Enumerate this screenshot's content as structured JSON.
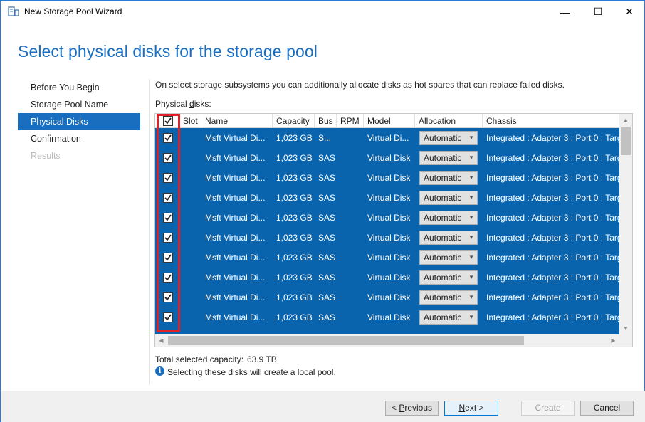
{
  "window": {
    "title": "New Storage Pool Wizard",
    "minimize_glyph": "—",
    "maximize_glyph": "☐",
    "close_glyph": "✕"
  },
  "page": {
    "heading": "Select physical disks for the storage pool",
    "intro": "On select storage subsystems you can additionally allocate disks as hot spares that can replace failed disks.",
    "physical_disks_label_prefix": "Physical ",
    "physical_disks_label_underlined": "d",
    "physical_disks_label_suffix": "isks:"
  },
  "nav": {
    "items": [
      {
        "label": "Before You Begin",
        "state": "normal"
      },
      {
        "label": "Storage Pool Name",
        "state": "normal"
      },
      {
        "label": "Physical Disks",
        "state": "active"
      },
      {
        "label": "Confirmation",
        "state": "normal"
      },
      {
        "label": "Results",
        "state": "disabled"
      }
    ]
  },
  "grid": {
    "columns": [
      "Slot",
      "Name",
      "Capacity",
      "Bus",
      "RPM",
      "Model",
      "Allocation",
      "Chassis"
    ],
    "rows": [
      {
        "checked": true,
        "slot": "",
        "name": "Msft Virtual Di...",
        "capacity": "1,023 GB",
        "bus": "S...",
        "rpm": "",
        "model": "Virtual Di...",
        "allocation": "Automatic",
        "chassis": "Integrated : Adapter 3 : Port 0 : Targ"
      },
      {
        "checked": true,
        "slot": "",
        "name": "Msft Virtual Di...",
        "capacity": "1,023 GB",
        "bus": "SAS",
        "rpm": "",
        "model": "Virtual Disk",
        "allocation": "Automatic",
        "chassis": "Integrated : Adapter 3 : Port 0 : Targ"
      },
      {
        "checked": true,
        "slot": "",
        "name": "Msft Virtual Di...",
        "capacity": "1,023 GB",
        "bus": "SAS",
        "rpm": "",
        "model": "Virtual Disk",
        "allocation": "Automatic",
        "chassis": "Integrated : Adapter 3 : Port 0 : Targ"
      },
      {
        "checked": true,
        "slot": "",
        "name": "Msft Virtual Di...",
        "capacity": "1,023 GB",
        "bus": "SAS",
        "rpm": "",
        "model": "Virtual Disk",
        "allocation": "Automatic",
        "chassis": "Integrated : Adapter 3 : Port 0 : Targ"
      },
      {
        "checked": true,
        "slot": "",
        "name": "Msft Virtual Di...",
        "capacity": "1,023 GB",
        "bus": "SAS",
        "rpm": "",
        "model": "Virtual Disk",
        "allocation": "Automatic",
        "chassis": "Integrated : Adapter 3 : Port 0 : Targ"
      },
      {
        "checked": true,
        "slot": "",
        "name": "Msft Virtual Di...",
        "capacity": "1,023 GB",
        "bus": "SAS",
        "rpm": "",
        "model": "Virtual Disk",
        "allocation": "Automatic",
        "chassis": "Integrated : Adapter 3 : Port 0 : Targ"
      },
      {
        "checked": true,
        "slot": "",
        "name": "Msft Virtual Di...",
        "capacity": "1,023 GB",
        "bus": "SAS",
        "rpm": "",
        "model": "Virtual Disk",
        "allocation": "Automatic",
        "chassis": "Integrated : Adapter 3 : Port 0 : Targ"
      },
      {
        "checked": true,
        "slot": "",
        "name": "Msft Virtual Di...",
        "capacity": "1,023 GB",
        "bus": "SAS",
        "rpm": "",
        "model": "Virtual Disk",
        "allocation": "Automatic",
        "chassis": "Integrated : Adapter 3 : Port 0 : Targ"
      },
      {
        "checked": true,
        "slot": "",
        "name": "Msft Virtual Di...",
        "capacity": "1,023 GB",
        "bus": "SAS",
        "rpm": "",
        "model": "Virtual Disk",
        "allocation": "Automatic",
        "chassis": "Integrated : Adapter 3 : Port 0 : Targ"
      },
      {
        "checked": true,
        "slot": "",
        "name": "Msft Virtual Di...",
        "capacity": "1,023 GB",
        "bus": "SAS",
        "rpm": "",
        "model": "Virtual Disk",
        "allocation": "Automatic",
        "chassis": "Integrated : Adapter 3 : Port 0 : Targ"
      }
    ]
  },
  "summary": {
    "total_label": "Total selected capacity:",
    "total_value": "63.9 TB",
    "info_text": "Selecting these disks will create a local pool."
  },
  "buttons": {
    "previous_prefix": "< ",
    "previous_underlined": "P",
    "previous_suffix": "revious",
    "next_underlined": "N",
    "next_suffix": "ext >",
    "create": "Create",
    "cancel": "Cancel"
  },
  "colors": {
    "accent": "#1a6ec0",
    "selected_row": "#0a64ad",
    "highlight_border": "#e01f26"
  }
}
